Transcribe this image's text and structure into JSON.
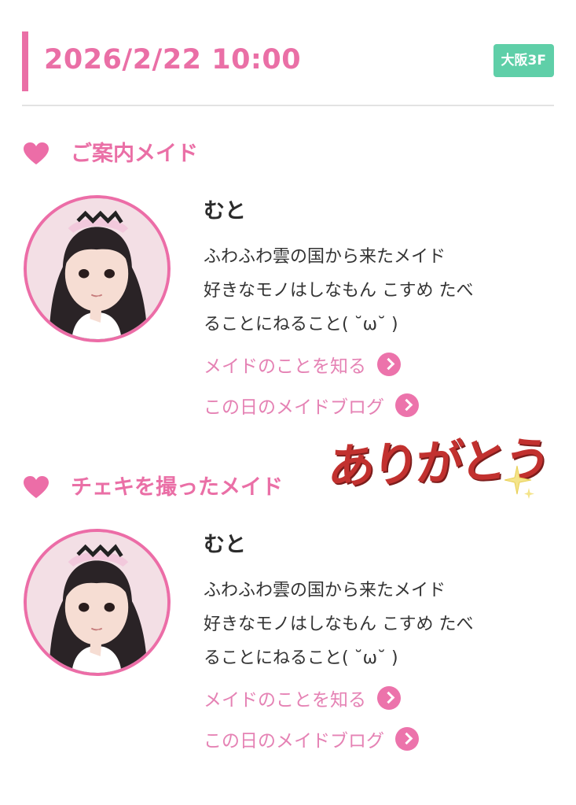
{
  "header": {
    "datetime": "2026/2/22 10:00",
    "store_badge": "大阪3F"
  },
  "sections": [
    {
      "title": "ご案内メイド",
      "maid": {
        "name": "むと",
        "description": [
          "ふわふわ雲の国から来たメイド",
          "好きなモノはしなもん こすめ たべ",
          "ることにねること( ˘ω˘ )"
        ],
        "link_profile": "メイドのことを知る",
        "link_blog": "この日のメイドブログ"
      }
    },
    {
      "title": "チェキを撮ったメイド",
      "maid": {
        "name": "むと",
        "description": [
          "ふわふわ雲の国から来たメイド",
          "好きなモノはしなもん こすめ たべ",
          "ることにねること( ˘ω˘ )"
        ],
        "link_profile": "メイドのことを知る",
        "link_blog": "この日のメイドブログ"
      }
    }
  ],
  "sticker": {
    "text": "ありがとう"
  },
  "colors": {
    "accent": "#ea6fa6",
    "badge": "#5fcfa8",
    "sticker": "#c2312f"
  }
}
